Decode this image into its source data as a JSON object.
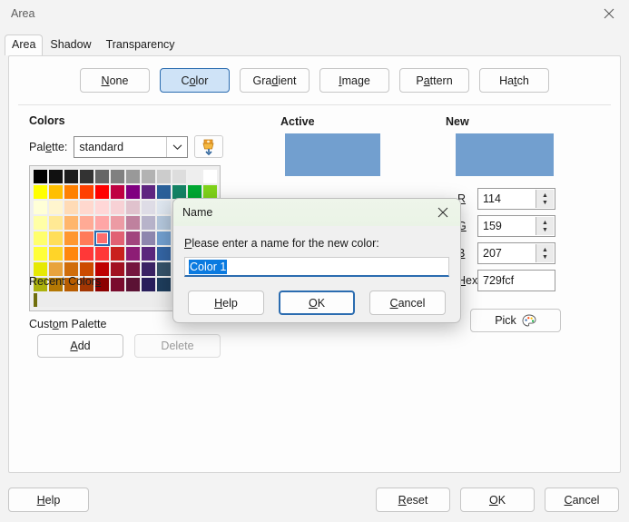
{
  "window": {
    "title": "Area",
    "close_icon": "close-icon"
  },
  "tabs": [
    {
      "label": "Area",
      "active": true
    },
    {
      "label": "Shadow",
      "active": false
    },
    {
      "label": "Transparency",
      "active": false
    }
  ],
  "fill_types": [
    {
      "label": "None",
      "accel": "N",
      "selected": false
    },
    {
      "label": "Color",
      "accel": "o",
      "selected": true
    },
    {
      "label": "Gradient",
      "accel": "d",
      "selected": false
    },
    {
      "label": "Image",
      "accel": "I",
      "selected": false
    },
    {
      "label": "Pattern",
      "accel": "a",
      "selected": false
    },
    {
      "label": "Hatch",
      "accel": "t",
      "selected": false
    }
  ],
  "colors_section": {
    "title": "Colors",
    "palette_label": "Palette:",
    "palette_value": "standard",
    "palette_chevron": "chevron-down-icon",
    "import_icon": "import-palette-icon",
    "selected_index": 52,
    "grid": [
      "#000000",
      "#111111",
      "#1c1c1c",
      "#333333",
      "#666666",
      "#808080",
      "#999999",
      "#b2b2b2",
      "#cccccc",
      "#dddddd",
      "#eeeeee",
      "#ffffff",
      "#ffff00",
      "#ffbf00",
      "#ff8000",
      "#ff4000",
      "#ff0000",
      "#bf0041",
      "#800080",
      "#5f2580",
      "#2a6099",
      "#158466",
      "#00a933",
      "#81d41a",
      "#ffffd7",
      "#fff5ce",
      "#ffdbb6",
      "#ffd8ce",
      "#ffd7d7",
      "#f7d1d5",
      "#e0c2cd",
      "#dedce6",
      "#dee6ef",
      "#dee7e5",
      "#dde8cb",
      "#f6f9d4",
      "#ffffa6",
      "#ffe994",
      "#ffb66c",
      "#ffaa95",
      "#ffa6a6",
      "#ec9ba4",
      "#bf819e",
      "#b7b3ca",
      "#b4c7dc",
      "#b3cac7",
      "#afd095",
      "#e8f2a1",
      "#ffff6d",
      "#ffde59",
      "#ff972f",
      "#ff7b59",
      "#ff6d6d",
      "#e16173",
      "#a1467e",
      "#8e86ae",
      "#729fcf",
      "#81acac",
      "#77bc65",
      "#d4ea6b",
      "#ffff38",
      "#ffd428",
      "#ff860d",
      "#ff3838",
      "#ff3838",
      "#c9211e",
      "#8d1d75",
      "#5b277d",
      "#3465a4",
      "#168253",
      "#00a933",
      "#acb20c",
      "#e6e905",
      "#e8a33d",
      "#d06d0b",
      "#cc4b00",
      "#bf0000",
      "#a11222",
      "#75163f",
      "#3b2364",
      "#355269",
      "#1c5a3f",
      "#127622",
      "#859900",
      "#acb20c",
      "#b47804",
      "#b85c00",
      "#a33603",
      "#8c0000",
      "#7a0c2e",
      "#5b1234",
      "#291e5b",
      "#1e3d5c",
      "#14512c",
      "#065f1a",
      "#6b7400",
      "#706e0c",
      "#784b04",
      "#7b3d00",
      "#662a00",
      "#600000",
      "#500f1e",
      "#3e0b24",
      "#1a1035",
      "#13263b",
      "#0a2e1a",
      "#03380f",
      "#454800"
    ],
    "recent_label": "Recent Colors",
    "custom_label": "Custom Palette",
    "add_label": "Add",
    "add_accel": "A",
    "delete_label": "Delete",
    "delete_disabled": true
  },
  "preview": {
    "active_label": "Active",
    "active_color": "#729fcf",
    "new_label": "New",
    "new_color": "#729fcf"
  },
  "fields": [
    {
      "label": "R",
      "value": "114",
      "spinner": true
    },
    {
      "label": "G",
      "value": "159",
      "spinner": true
    },
    {
      "label": "B",
      "value": "207",
      "spinner": true
    },
    {
      "label": "Hex",
      "value": "729fcf",
      "spinner": false
    }
  ],
  "pick_button": {
    "label": "Pick",
    "icon": "color-palette-icon"
  },
  "bottom_bar": {
    "help": "Help",
    "help_accel": "H",
    "reset": "Reset",
    "reset_accel": "R",
    "ok": "OK",
    "ok_accel": "O",
    "cancel": "Cancel",
    "cancel_accel": "C"
  },
  "name_dialog": {
    "title": "Name",
    "close_icon": "close-icon",
    "prompt": "Please enter a name for the new color:",
    "input_value": "Color 1",
    "help": "Help",
    "help_accel": "H",
    "ok": "OK",
    "ok_accel": "O",
    "cancel": "Cancel",
    "cancel_accel": "C"
  },
  "theme": {
    "accent": "#2b6cb0",
    "selection": "#0a7ae0",
    "selected_fill": "#cfe3f7"
  }
}
